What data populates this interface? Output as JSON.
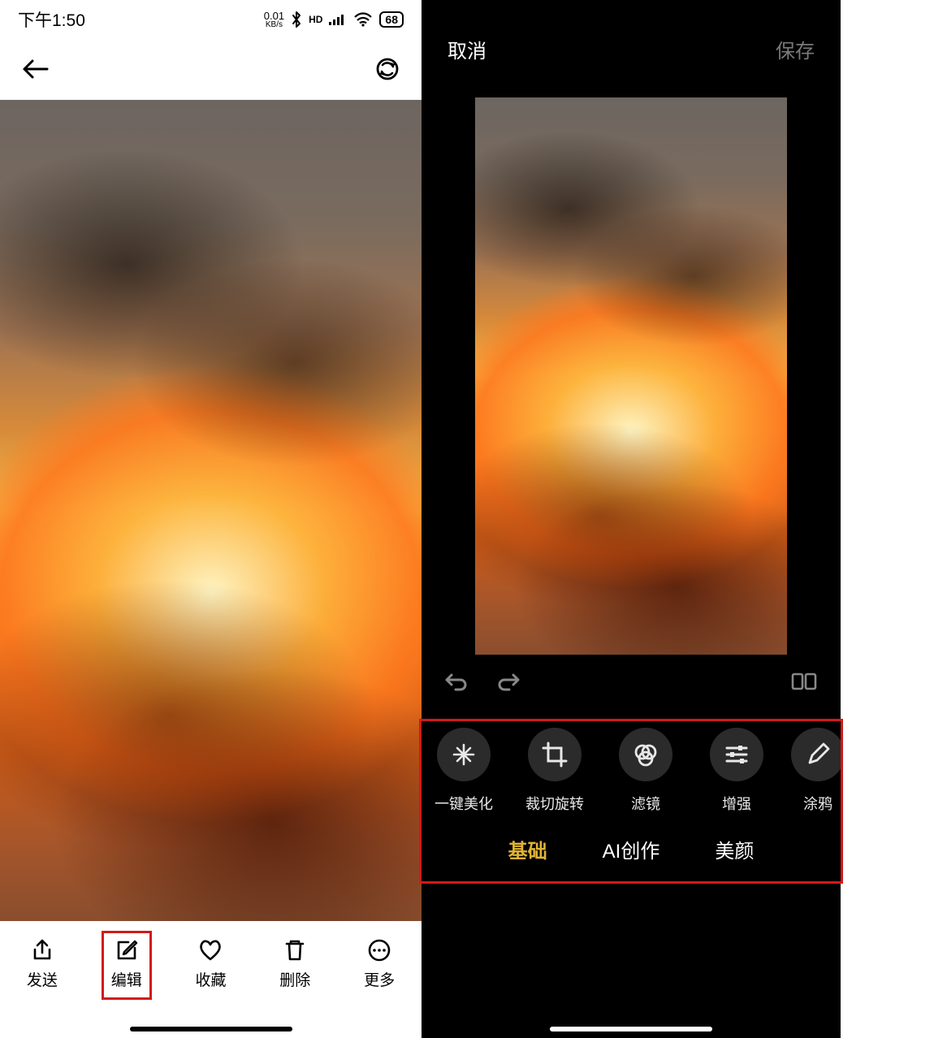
{
  "status": {
    "time": "下午1:50",
    "net_speed_value": "0.01",
    "net_speed_unit": "KB/s",
    "hd": "HD",
    "battery": "68"
  },
  "left": {
    "actions": {
      "send": "发送",
      "edit": "编辑",
      "favorite": "收藏",
      "delete": "删除",
      "more": "更多"
    }
  },
  "right": {
    "cancel": "取消",
    "save": "保存",
    "tools": {
      "beautify": "一键美化",
      "crop": "裁切旋转",
      "filter": "滤镜",
      "enhance": "增强",
      "doodle": "涂鸦"
    },
    "tabs": {
      "basic": "基础",
      "ai": "AI创作",
      "beauty": "美颜"
    }
  }
}
